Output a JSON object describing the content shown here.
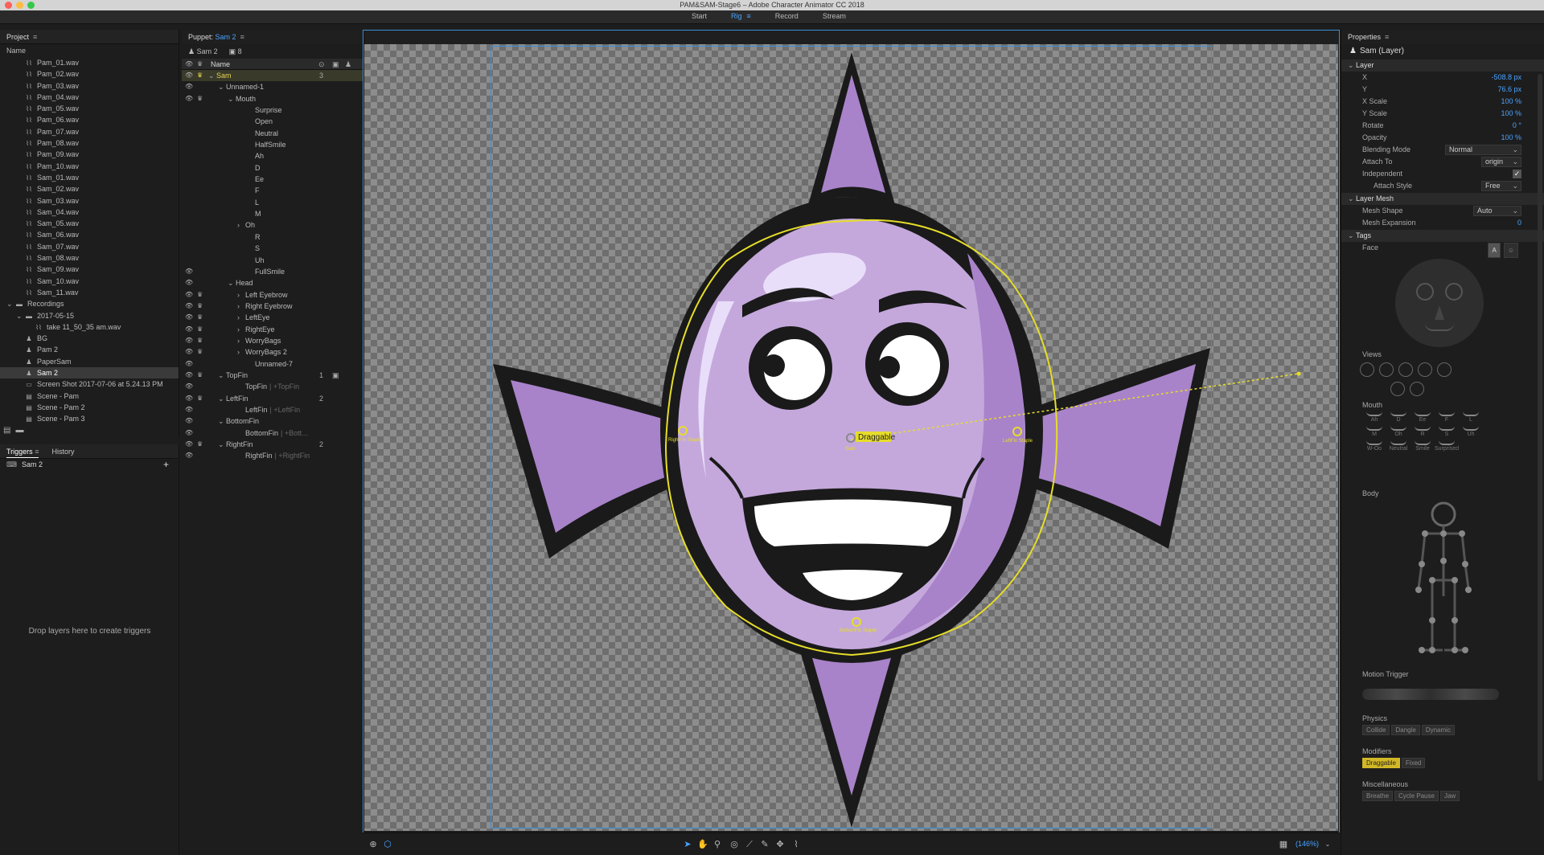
{
  "window": {
    "title": "PAM&SAM-Stage6 – Adobe Character Animator CC 2018"
  },
  "modes": [
    {
      "label": "Start",
      "active": false
    },
    {
      "label": "Rig",
      "active": true
    },
    {
      "label": "Record",
      "active": false
    },
    {
      "label": "Stream",
      "active": false
    }
  ],
  "project": {
    "title": "Project",
    "column": "Name",
    "items": [
      {
        "label": "Pam_01.wav",
        "indent": 1,
        "icon": "audio-icon",
        "glyph": "⌇⌇"
      },
      {
        "label": "Pam_02.wav",
        "indent": 1,
        "icon": "audio-icon",
        "glyph": "⌇⌇"
      },
      {
        "label": "Pam_03.wav",
        "indent": 1,
        "icon": "audio-icon",
        "glyph": "⌇⌇"
      },
      {
        "label": "Pam_04.wav",
        "indent": 1,
        "icon": "audio-icon",
        "glyph": "⌇⌇"
      },
      {
        "label": "Pam_05.wav",
        "indent": 1,
        "icon": "audio-icon",
        "glyph": "⌇⌇"
      },
      {
        "label": "Pam_06.wav",
        "indent": 1,
        "icon": "audio-icon",
        "glyph": "⌇⌇"
      },
      {
        "label": "Pam_07.wav",
        "indent": 1,
        "icon": "audio-icon",
        "glyph": "⌇⌇"
      },
      {
        "label": "Pam_08.wav",
        "indent": 1,
        "icon": "audio-icon",
        "glyph": "⌇⌇"
      },
      {
        "label": "Pam_09.wav",
        "indent": 1,
        "icon": "audio-icon",
        "glyph": "⌇⌇"
      },
      {
        "label": "Pam_10.wav",
        "indent": 1,
        "icon": "audio-icon",
        "glyph": "⌇⌇"
      },
      {
        "label": "Sam_01.wav",
        "indent": 1,
        "icon": "audio-icon",
        "glyph": "⌇⌇"
      },
      {
        "label": "Sam_02.wav",
        "indent": 1,
        "icon": "audio-icon",
        "glyph": "⌇⌇"
      },
      {
        "label": "Sam_03.wav",
        "indent": 1,
        "icon": "audio-icon",
        "glyph": "⌇⌇"
      },
      {
        "label": "Sam_04.wav",
        "indent": 1,
        "icon": "audio-icon",
        "glyph": "⌇⌇"
      },
      {
        "label": "Sam_05.wav",
        "indent": 1,
        "icon": "audio-icon",
        "glyph": "⌇⌇"
      },
      {
        "label": "Sam_06.wav",
        "indent": 1,
        "icon": "audio-icon",
        "glyph": "⌇⌇"
      },
      {
        "label": "Sam_07.wav",
        "indent": 1,
        "icon": "audio-icon",
        "glyph": "⌇⌇"
      },
      {
        "label": "Sam_08.wav",
        "indent": 1,
        "icon": "audio-icon",
        "glyph": "⌇⌇"
      },
      {
        "label": "Sam_09.wav",
        "indent": 1,
        "icon": "audio-icon",
        "glyph": "⌇⌇"
      },
      {
        "label": "Sam_10.wav",
        "indent": 1,
        "icon": "audio-icon",
        "glyph": "⌇⌇"
      },
      {
        "label": "Sam_11.wav",
        "indent": 1,
        "icon": "audio-icon",
        "glyph": "⌇⌇"
      },
      {
        "label": "Recordings",
        "indent": 0,
        "icon": "folder-icon",
        "glyph": "▬",
        "caret": "⌄"
      },
      {
        "label": "2017-05-15",
        "indent": 1,
        "icon": "folder-icon",
        "glyph": "▬",
        "caret": "⌄"
      },
      {
        "label": "take 11_50_35 am.wav",
        "indent": 2,
        "icon": "audio-icon",
        "glyph": "⌇⌇"
      },
      {
        "label": "BG",
        "indent": 1,
        "icon": "puppet-icon",
        "glyph": "♟"
      },
      {
        "label": "Pam 2",
        "indent": 1,
        "icon": "puppet-icon",
        "glyph": "♟"
      },
      {
        "label": "PaperSam",
        "indent": 1,
        "icon": "puppet-icon",
        "glyph": "♟"
      },
      {
        "label": "Sam 2",
        "indent": 1,
        "icon": "puppet-icon",
        "glyph": "♟",
        "selected": true
      },
      {
        "label": "Screen Shot 2017-07-06 at 5.24.13 PM",
        "indent": 1,
        "icon": "image-icon",
        "glyph": "▭"
      },
      {
        "label": "Scene - Pam",
        "indent": 1,
        "icon": "scene-icon",
        "glyph": "▤"
      },
      {
        "label": "Scene - Pam 2",
        "indent": 1,
        "icon": "scene-icon",
        "glyph": "▤"
      },
      {
        "label": "Scene - Pam 3",
        "indent": 1,
        "icon": "scene-icon",
        "glyph": "▤"
      }
    ]
  },
  "triggers": {
    "tabs": [
      {
        "label": "Triggers",
        "active": true
      },
      {
        "label": "History",
        "active": false
      }
    ],
    "row_label": "Sam 2",
    "add_glyph": "+",
    "drop_hint": "Drop layers here to create triggers"
  },
  "puppet": {
    "header_label": "Puppet:",
    "name": "Sam 2",
    "info_name": "Sam 2",
    "info_count": "8",
    "name_column": "Name",
    "layers": [
      {
        "label": "Sam",
        "indent": 0,
        "eye": true,
        "crown": true,
        "caret": "⌄",
        "num": "3",
        "selected": true
      },
      {
        "label": "Unnamed-1",
        "indent": 1,
        "eye": true,
        "crown": false,
        "caret": "⌄"
      },
      {
        "label": "Mouth",
        "indent": 2,
        "eye": true,
        "crown": true,
        "caret": "⌄"
      },
      {
        "label": "Surprise",
        "indent": 4
      },
      {
        "label": "Open",
        "indent": 4
      },
      {
        "label": "Neutral",
        "indent": 4
      },
      {
        "label": "HalfSmile",
        "indent": 4
      },
      {
        "label": "Ah",
        "indent": 4
      },
      {
        "label": "D",
        "indent": 4
      },
      {
        "label": "Ee",
        "indent": 4
      },
      {
        "label": "F",
        "indent": 4
      },
      {
        "label": "L",
        "indent": 4
      },
      {
        "label": "M",
        "indent": 4
      },
      {
        "label": "Oh",
        "indent": 3,
        "caret": "›"
      },
      {
        "label": "R",
        "indent": 4
      },
      {
        "label": "S",
        "indent": 4
      },
      {
        "label": "Uh",
        "indent": 4
      },
      {
        "label": "FullSmile",
        "indent": 4,
        "eye": true
      },
      {
        "label": "Head",
        "indent": 2,
        "eye": true,
        "caret": "⌄"
      },
      {
        "label": "Left Eyebrow",
        "indent": 3,
        "eye": true,
        "crown": true,
        "caret": "›"
      },
      {
        "label": "Right Eyebrow",
        "indent": 3,
        "eye": true,
        "crown": true,
        "caret": "›"
      },
      {
        "label": "LeftEye",
        "indent": 3,
        "eye": true,
        "crown": true,
        "caret": "›"
      },
      {
        "label": "RightEye",
        "indent": 3,
        "eye": true,
        "crown": true,
        "caret": "›"
      },
      {
        "label": "WorryBags",
        "indent": 3,
        "eye": true,
        "crown": true,
        "caret": "›"
      },
      {
        "label": "WorryBags 2",
        "indent": 3,
        "eye": true,
        "crown": true,
        "caret": "›"
      },
      {
        "label": "Unnamed-7",
        "indent": 4,
        "eye": true
      },
      {
        "label": "TopFin",
        "indent": 1,
        "eye": true,
        "crown": true,
        "caret": "⌄",
        "num": "1",
        "cam": true
      },
      {
        "label": "TopFin",
        "indent": 3,
        "eye": true,
        "sub": "| +TopFin"
      },
      {
        "label": "LeftFin",
        "indent": 1,
        "eye": true,
        "crown": true,
        "caret": "⌄",
        "num": "2"
      },
      {
        "label": "LeftFin",
        "indent": 3,
        "eye": true,
        "sub": "| +LeftFin"
      },
      {
        "label": "BottomFin",
        "indent": 1,
        "eye": true,
        "caret": "⌄"
      },
      {
        "label": "BottomFin",
        "indent": 3,
        "eye": true,
        "sub": "| +Bott..."
      },
      {
        "label": "RightFin",
        "indent": 1,
        "eye": true,
        "crown": true,
        "caret": "⌄",
        "num": "2"
      },
      {
        "label": "RightFin",
        "indent": 3,
        "eye": true,
        "sub": "| +RightFin"
      }
    ]
  },
  "stage": {
    "draggable_label": "Draggable",
    "draggable_sub": "Sam",
    "handles": [
      {
        "label": "RightFin Staple",
        "name": "rightfin-staple-handle"
      },
      {
        "label": "LeftFin Staple",
        "name": "leftfin-staple-handle"
      },
      {
        "label": "BottomFin Staple",
        "name": "bottomfin-staple-handle"
      }
    ],
    "zoom": "(146%)",
    "tools": [
      {
        "name": "select-tool-icon",
        "glyph": "➤",
        "active": true
      },
      {
        "name": "hand-tool-icon",
        "glyph": "✋",
        "active": false
      },
      {
        "name": "zoom-tool-icon",
        "glyph": "⚲",
        "active": false
      },
      {
        "name": "origin-tool-icon",
        "glyph": "◎",
        "active": false
      },
      {
        "name": "stick-tool-icon",
        "glyph": "⟋",
        "active": false
      },
      {
        "name": "pin-tool-icon",
        "glyph": "✎",
        "active": false
      },
      {
        "name": "handle-tool-icon",
        "glyph": "✥",
        "active": false
      },
      {
        "name": "dangle-tool-icon",
        "glyph": "⌇",
        "active": false
      }
    ],
    "colors": {
      "body": "#c4a8dc",
      "fin": "#a883c9",
      "outline": "#1a1a1a",
      "mesh": "#e6dd2a",
      "selection": "#3b8fd6"
    }
  },
  "properties": {
    "title": "Properties",
    "layer_name": "Sam (Layer)",
    "sections": {
      "layer": "Layer",
      "layer_mesh": "Layer Mesh",
      "tags": "Tags"
    },
    "layer": {
      "x_label": "X",
      "x_value": "-508.8 px",
      "y_label": "Y",
      "y_value": "76.6 px",
      "xscale_label": "X Scale",
      "xscale_value": "100 %",
      "yscale_label": "Y Scale",
      "yscale_value": "100 %",
      "rotate_label": "Rotate",
      "rotate_value": "0 °",
      "opacity_label": "Opacity",
      "opacity_value": "100 %",
      "blending_label": "Blending Mode",
      "blending_value": "Normal",
      "attach_label": "Attach To",
      "attach_value": "origin",
      "independent_label": "Independent",
      "independent_checked": true,
      "attach_style_label": "Attach Style",
      "attach_style_value": "Free"
    },
    "mesh": {
      "shape_label": "Mesh Shape",
      "shape_value": "Auto",
      "expansion_label": "Mesh Expansion",
      "expansion_value": "0"
    },
    "tags": {
      "face_label": "Face",
      "face_btn": "A",
      "views_label": "Views",
      "mouth_label": "Mouth",
      "mouth_row1": [
        "Ah",
        "D",
        "Ee",
        "F",
        "L"
      ],
      "mouth_row2": [
        "M",
        "Oh",
        "R",
        "S",
        "Uh"
      ],
      "mouth_row3": [
        "W-Oo",
        "Neutral",
        "Smile",
        "Surprised"
      ],
      "body_label": "Body",
      "motion_label": "Motion Trigger",
      "physics_label": "Physics",
      "physics": [
        "Collide",
        "Dangle",
        "Dynamic"
      ],
      "modifiers_label": "Modifiers",
      "modifiers": [
        {
          "label": "Draggable",
          "on": true
        },
        {
          "label": "Fixed",
          "on": false
        }
      ],
      "misc_label": "Miscellaneous",
      "misc": [
        "Breathe",
        "Cycle Pause",
        "Jaw"
      ]
    }
  }
}
